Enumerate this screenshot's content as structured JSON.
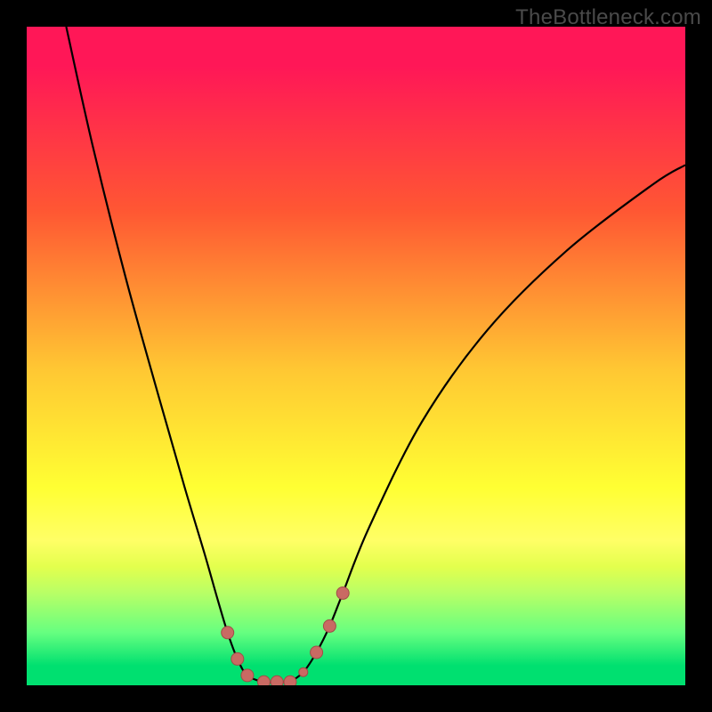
{
  "watermark": "TheBottleneck.com",
  "chart_data": {
    "type": "line",
    "title": "",
    "xlabel": "",
    "ylabel": "",
    "xlim": [
      0,
      100
    ],
    "ylim": [
      0,
      100
    ],
    "grid": false,
    "series": [
      {
        "name": "left-branch",
        "x": [
          6,
          10,
          15,
          20,
          24,
          27,
          29,
          30.5,
          32,
          33.5,
          36,
          38,
          40
        ],
        "y": [
          100,
          82,
          62,
          44,
          30,
          20,
          13,
          8,
          4,
          1.5,
          0.5,
          0.5,
          0.5
        ]
      },
      {
        "name": "right-branch",
        "x": [
          40,
          42,
          44,
          46,
          48,
          52,
          60,
          70,
          82,
          95,
          100
        ],
        "y": [
          0.5,
          2,
          5,
          9,
          14,
          24,
          40,
          54,
          66,
          76,
          79
        ]
      }
    ],
    "markers": {
      "name": "data-points",
      "points": [
        {
          "x": 30.5,
          "y": 8,
          "r": 7
        },
        {
          "x": 32,
          "y": 4,
          "r": 7
        },
        {
          "x": 33.5,
          "y": 1.5,
          "r": 7
        },
        {
          "x": 36,
          "y": 0.5,
          "r": 7
        },
        {
          "x": 38,
          "y": 0.5,
          "r": 7
        },
        {
          "x": 40,
          "y": 0.5,
          "r": 7
        },
        {
          "x": 42,
          "y": 2,
          "r": 5
        },
        {
          "x": 44,
          "y": 5,
          "r": 7
        },
        {
          "x": 46,
          "y": 9,
          "r": 7
        },
        {
          "x": 48,
          "y": 14,
          "r": 7
        }
      ]
    },
    "colors": {
      "gradient_top": "#ff1757",
      "gradient_bottom": "#00e070",
      "curve": "#000000",
      "marker_fill": "#c96a63",
      "frame": "#000000"
    }
  }
}
